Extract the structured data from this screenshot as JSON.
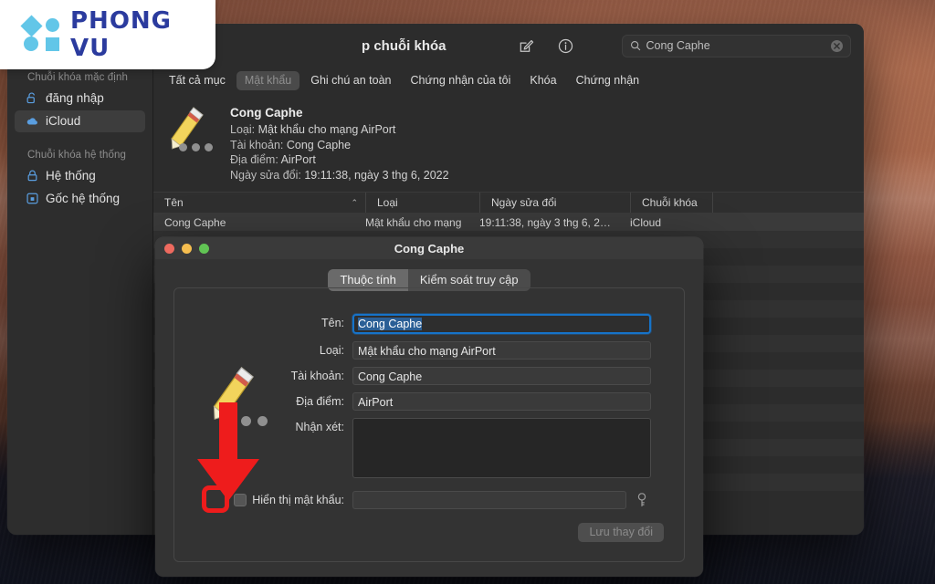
{
  "overlay_logo": {
    "text": "PHONG VU"
  },
  "window": {
    "title": "p chuỗi khóa",
    "toolbar_icons": [
      "compose-icon",
      "info-icon"
    ],
    "search": {
      "value": "Cong Caphe",
      "icon": "search-icon",
      "clear": "clear-icon"
    },
    "categories": [
      {
        "label": "Tất cả mục",
        "selected": false
      },
      {
        "label": "Mật khẩu",
        "selected": true
      },
      {
        "label": "Ghi chú an toàn",
        "selected": false
      },
      {
        "label": "Chứng nhận của tôi",
        "selected": false
      },
      {
        "label": "Khóa",
        "selected": false
      },
      {
        "label": "Chứng nhận",
        "selected": false
      }
    ]
  },
  "sidebar": {
    "group1_title": "Chuỗi khóa mặc định",
    "group1_items": [
      {
        "label": "đăng nhập",
        "icon": "unlock-icon",
        "selected": false
      },
      {
        "label": "iCloud",
        "icon": "cloud-icon",
        "selected": true
      }
    ],
    "group2_title": "Chuỗi khóa hệ thống",
    "group2_items": [
      {
        "label": "Hệ thống",
        "icon": "lock-icon",
        "selected": false
      },
      {
        "label": "Gốc hệ thống",
        "icon": "lock-box-icon",
        "selected": false
      }
    ]
  },
  "detail": {
    "icon": "pencil-icon",
    "title": "Cong Caphe",
    "type_label": "Loại:",
    "type_value": "Mật khẩu cho mạng AirPort",
    "account_label": "Tài khoản:",
    "account_value": "Cong Caphe",
    "location_label": "Địa điểm:",
    "location_value": "AirPort",
    "modified_label": "Ngày sửa đổi:",
    "modified_value": "19:11:38, ngày 3 thg 6, 2022"
  },
  "table": {
    "columns": [
      "Tên",
      "Loại",
      "Ngày sửa đổi",
      "Chuỗi khóa"
    ],
    "sort_caret": "⌃",
    "rows": [
      {
        "name": "Cong Caphe",
        "type": "Mật khẩu cho mạng",
        "modified": "19:11:38, ngày 3 thg 6, 2…",
        "keychain": "iCloud"
      }
    ]
  },
  "dialog": {
    "title": "Cong Caphe",
    "tabs": [
      {
        "label": "Thuộc tính",
        "selected": true
      },
      {
        "label": "Kiểm soát truy cập",
        "selected": false
      }
    ],
    "icon": "pencil-icon",
    "fields": [
      {
        "label": "Tên:",
        "value": "Cong Caphe",
        "focused": true
      },
      {
        "label": "Loại:",
        "value": "Mật khẩu cho mạng AirPort",
        "focused": false
      },
      {
        "label": "Tài khoản:",
        "value": "Cong Caphe",
        "focused": false
      },
      {
        "label": "Địa điểm:",
        "value": "AirPort",
        "focused": false
      }
    ],
    "comment_label": "Nhận xét:",
    "comment_value": "",
    "show_password_label": "Hiển thị mật khẩu:",
    "show_password_checked": false,
    "password_value": "",
    "key_icon": "key-icon",
    "save_button": "Lưu thay đổi",
    "save_button_disabled": true
  },
  "annotations": {
    "arrow_color": "#ee1c1c",
    "highlight_color": "#ee1c1c",
    "arrow_target": "show-password-checkbox"
  }
}
